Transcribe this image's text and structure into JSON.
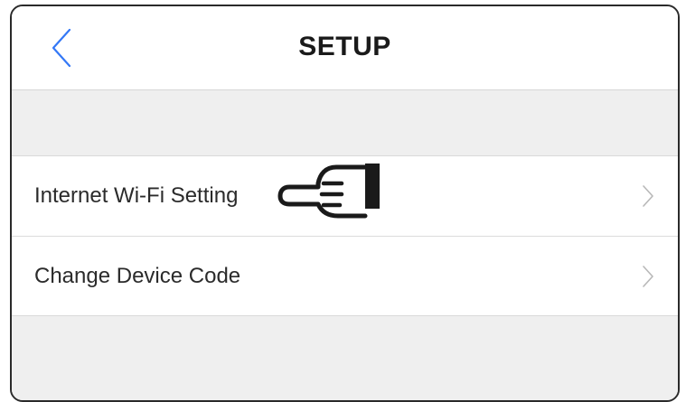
{
  "nav": {
    "title": "SETUP",
    "back_icon": "chevron-left-icon"
  },
  "settings": {
    "items": [
      {
        "label": "Internet Wi-Fi Setting",
        "icon": "chevron-right-icon"
      },
      {
        "label": "Change Device Code",
        "icon": "chevron-right-icon"
      }
    ]
  },
  "annotation": {
    "icon": "pointing-hand-icon"
  },
  "colors": {
    "accent": "#3478f6",
    "chevron": "#b8b8b8",
    "group_background": "#efefef",
    "separator": "#d9d9d9"
  }
}
